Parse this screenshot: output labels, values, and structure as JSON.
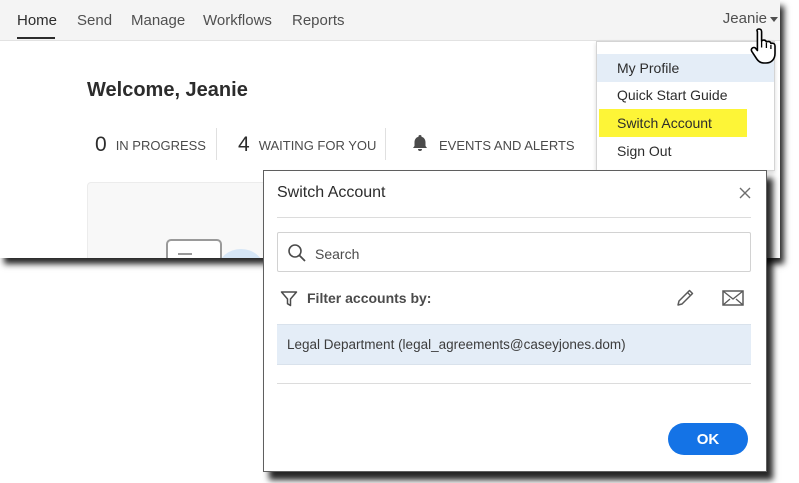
{
  "nav": {
    "tabs": [
      {
        "label": "Home"
      },
      {
        "label": "Send"
      },
      {
        "label": "Manage"
      },
      {
        "label": "Workflows"
      },
      {
        "label": "Reports"
      }
    ],
    "user": "Jeanie"
  },
  "welcome": "Welcome, Jeanie",
  "stats": {
    "in_progress": {
      "count": "0",
      "label": "IN PROGRESS"
    },
    "waiting": {
      "count": "4",
      "label": "WAITING FOR YOU"
    },
    "events": {
      "label": "EVENTS AND ALERTS",
      "icon": "bell-icon"
    }
  },
  "user_menu": {
    "items": [
      {
        "label": "My Profile"
      },
      {
        "label": "Quick Start Guide"
      },
      {
        "label": "Switch Account"
      },
      {
        "label": "Sign Out"
      }
    ],
    "highlight_color": "#fdf537",
    "hover_color": "#e4edf7"
  },
  "modal": {
    "title": "Switch Account",
    "search_placeholder": "Search",
    "filter_label": "Filter accounts by:",
    "accounts": [
      {
        "label": "Legal Department (legal_agreements@caseyjones.dom)"
      }
    ],
    "ok_label": "OK",
    "accent_color": "#1473e6"
  }
}
